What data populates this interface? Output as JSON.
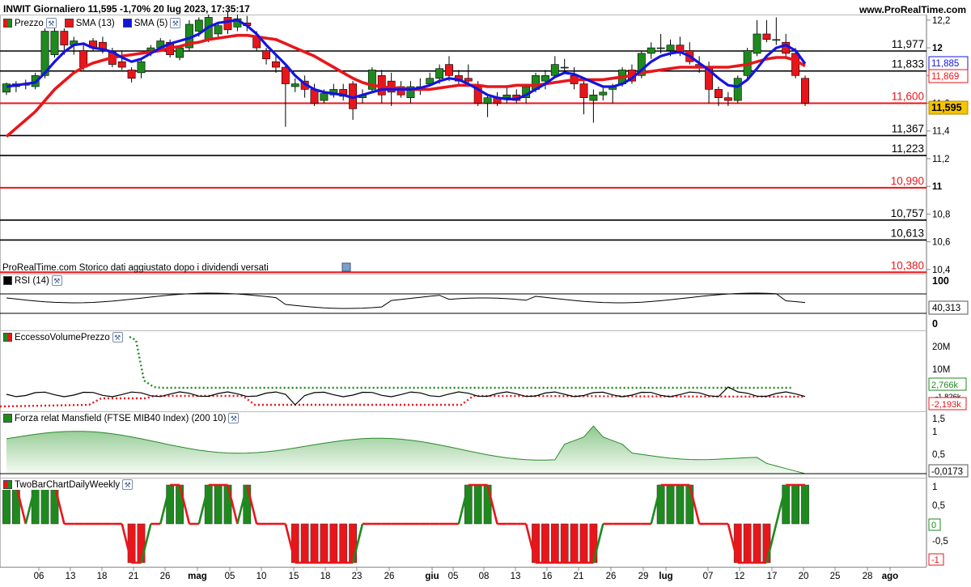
{
  "header": {
    "title": "INWIT Giornaliero 11,595 -1,70% 20 lug 2023, 17:35:17",
    "site": "www.ProRealTime.com"
  },
  "legend_price": [
    {
      "label": "Prezzo",
      "color": "#1e8a1e"
    },
    {
      "label": "SMA (13)",
      "color": "#e8161b"
    },
    {
      "label": "SMA (5)",
      "color": "#1414e0"
    }
  ],
  "note": "ProRealTime.com  Storico dati aggiustato dopo i dividendi versati",
  "panels": {
    "rsi": {
      "label": "RSI (14)",
      "value": "40,313",
      "ticks": [
        "100",
        "0"
      ]
    },
    "evp": {
      "label": "EccessoVolumePrezzo",
      "ticks": [
        "20M",
        "10M"
      ],
      "values": [
        "2,766k",
        "-1,826k",
        "-2,193k"
      ]
    },
    "mans": {
      "label": "Forza relat Mansfield (FTSE MIB40 Index) (200 10)",
      "ticks": [
        "1,5",
        "1",
        "0,5"
      ],
      "value": "-0,0173"
    },
    "twobar": {
      "label": "TwoBarChartDailyWeekly",
      "ticks": [
        "1",
        "0,5",
        "-0,5"
      ],
      "tags": [
        "0",
        "-1"
      ]
    }
  },
  "colors": {
    "up": "#1e8a1e",
    "down": "#e8161b",
    "sma13": "#e8161b",
    "sma5": "#1414e0",
    "blackline": "#000000"
  },
  "chart_data": {
    "type": "candlestick",
    "ylim": [
      10.37,
      12.24
    ],
    "price_ticks": [
      "12,2",
      "12",
      "11,8",
      "11,6",
      "11,4",
      "11,2",
      "11",
      "10,8",
      "10,6",
      "10,4"
    ],
    "x_tick_labels": [
      "06",
      "13",
      "18",
      "21",
      "26",
      "mag",
      "05",
      "10",
      "15",
      "18",
      "23",
      "26",
      "giu",
      "05",
      "08",
      "13",
      "16",
      "21",
      "26",
      "29",
      "lug",
      "07",
      "12",
      "17",
      "20",
      "25",
      "28",
      "ago"
    ],
    "current_price": "11,595",
    "sma5_last": "11,885",
    "sma13_last": "11,869",
    "levels": [
      {
        "value": 11.977,
        "label": "11,977",
        "kind": "black"
      },
      {
        "value": 11.833,
        "label": "11,833",
        "kind": "black"
      },
      {
        "value": 11.6,
        "label": "11,600",
        "kind": "red"
      },
      {
        "value": 11.367,
        "label": "11,367",
        "kind": "black"
      },
      {
        "value": 11.223,
        "label": "11,223",
        "kind": "black"
      },
      {
        "value": 10.99,
        "label": "10,990",
        "kind": "red"
      },
      {
        "value": 10.757,
        "label": "10,757",
        "kind": "black"
      },
      {
        "value": 10.613,
        "label": "10,613",
        "kind": "black"
      },
      {
        "value": 10.38,
        "label": "10,380",
        "kind": "red"
      }
    ],
    "candles": [
      [
        11.68,
        11.75,
        11.66,
        11.74
      ],
      [
        11.72,
        11.76,
        11.68,
        11.74
      ],
      [
        11.74,
        11.77,
        11.7,
        11.73
      ],
      [
        11.72,
        11.82,
        11.7,
        11.8
      ],
      [
        11.8,
        12.15,
        11.78,
        12.12
      ],
      [
        11.95,
        12.14,
        11.93,
        12.12
      ],
      [
        12.12,
        12.14,
        11.95,
        12.02
      ],
      [
        12.02,
        12.08,
        11.95,
        12.05
      ],
      [
        11.98,
        12.04,
        11.84,
        11.86
      ],
      [
        12.05,
        12.07,
        11.98,
        12.0
      ],
      [
        12.04,
        12.08,
        11.96,
        11.99
      ],
      [
        11.97,
        12.0,
        11.86,
        11.88
      ],
      [
        11.9,
        11.98,
        11.84,
        11.86
      ],
      [
        11.84,
        11.86,
        11.75,
        11.78
      ],
      [
        11.82,
        11.92,
        11.78,
        11.9
      ],
      [
        11.98,
        12.02,
        11.94,
        12.0
      ],
      [
        12.0,
        12.07,
        11.98,
        12.05
      ],
      [
        12.04,
        12.06,
        11.93,
        11.95
      ],
      [
        11.93,
        12.02,
        11.91,
        12.0
      ],
      [
        12.0,
        12.2,
        11.98,
        12.17
      ],
      [
        12.12,
        12.22,
        12.08,
        12.2
      ],
      [
        12.06,
        12.24,
        12.04,
        12.22
      ],
      [
        12.1,
        12.18,
        12.06,
        12.16
      ],
      [
        12.22,
        12.26,
        12.1,
        12.13
      ],
      [
        12.15,
        12.24,
        12.12,
        12.21
      ],
      [
        12.18,
        12.23,
        12.12,
        12.16
      ],
      [
        12.08,
        12.12,
        11.98,
        12.0
      ],
      [
        11.98,
        12.0,
        11.88,
        11.92
      ],
      [
        11.9,
        11.94,
        11.82,
        11.86
      ],
      [
        11.86,
        11.88,
        11.43,
        11.74
      ],
      [
        11.72,
        11.78,
        11.68,
        11.74
      ],
      [
        11.76,
        11.8,
        11.64,
        11.7
      ],
      [
        11.7,
        11.74,
        11.58,
        11.6
      ],
      [
        11.62,
        11.7,
        11.6,
        11.67
      ],
      [
        11.66,
        11.74,
        11.64,
        11.7
      ],
      [
        11.7,
        11.74,
        11.62,
        11.65
      ],
      [
        11.74,
        11.76,
        11.48,
        11.56
      ],
      [
        11.64,
        11.7,
        11.6,
        11.66
      ],
      [
        11.7,
        11.86,
        11.68,
        11.84
      ],
      [
        11.8,
        11.84,
        11.6,
        11.66
      ],
      [
        11.76,
        11.82,
        11.58,
        11.68
      ],
      [
        11.72,
        11.76,
        11.64,
        11.66
      ],
      [
        11.64,
        11.76,
        11.6,
        11.72
      ],
      [
        11.7,
        11.78,
        11.66,
        11.72
      ],
      [
        11.74,
        11.82,
        11.72,
        11.78
      ],
      [
        11.78,
        11.88,
        11.74,
        11.85
      ],
      [
        11.88,
        11.94,
        11.76,
        11.8
      ],
      [
        11.8,
        11.84,
        11.74,
        11.76
      ],
      [
        11.78,
        11.88,
        11.74,
        11.76
      ],
      [
        11.72,
        11.76,
        11.58,
        11.6
      ],
      [
        11.6,
        11.66,
        11.5,
        11.64
      ],
      [
        11.64,
        11.68,
        11.58,
        11.6
      ],
      [
        11.64,
        11.72,
        11.6,
        11.66
      ],
      [
        11.66,
        11.7,
        11.6,
        11.62
      ],
      [
        11.64,
        11.74,
        11.6,
        11.72
      ],
      [
        11.7,
        11.82,
        11.68,
        11.8
      ],
      [
        11.76,
        11.84,
        11.7,
        11.8
      ],
      [
        11.8,
        11.94,
        11.78,
        11.88
      ],
      [
        11.86,
        11.92,
        11.82,
        11.86
      ],
      [
        11.8,
        11.86,
        11.7,
        11.74
      ],
      [
        11.74,
        11.76,
        11.52,
        11.64
      ],
      [
        11.62,
        11.7,
        11.46,
        11.66
      ],
      [
        11.66,
        11.72,
        11.62,
        11.68
      ],
      [
        11.7,
        11.74,
        11.6,
        11.72
      ],
      [
        11.74,
        11.86,
        11.72,
        11.84
      ],
      [
        11.84,
        11.88,
        11.74,
        11.76
      ],
      [
        11.8,
        11.98,
        11.78,
        11.96
      ],
      [
        11.96,
        12.04,
        11.92,
        12.0
      ],
      [
        12.0,
        12.1,
        11.96,
        12.0
      ],
      [
        11.98,
        12.06,
        11.94,
        12.02
      ],
      [
        12.02,
        12.08,
        11.94,
        11.96
      ],
      [
        11.98,
        12.04,
        11.88,
        11.9
      ],
      [
        11.88,
        11.94,
        11.82,
        11.86
      ],
      [
        11.86,
        11.9,
        11.6,
        11.7
      ],
      [
        11.7,
        11.72,
        11.58,
        11.64
      ],
      [
        11.64,
        11.68,
        11.58,
        11.62
      ],
      [
        11.62,
        11.8,
        11.6,
        11.78
      ],
      [
        11.8,
        12.0,
        11.78,
        11.98
      ],
      [
        11.96,
        12.2,
        11.94,
        12.1
      ],
      [
        12.1,
        12.2,
        12.04,
        12.06
      ],
      [
        12.06,
        12.22,
        12.02,
        12.06
      ],
      [
        12.04,
        12.1,
        11.92,
        11.96
      ],
      [
        11.96,
        12.0,
        11.78,
        11.8
      ],
      [
        11.78,
        11.8,
        11.58,
        11.6
      ]
    ],
    "sma5": [
      11.72,
      11.73,
      11.74,
      11.75,
      11.82,
      11.9,
      11.97,
      12.02,
      12.03,
      12.0,
      11.99,
      11.97,
      11.93,
      11.9,
      11.92,
      11.96,
      12.0,
      12.03,
      12.05,
      12.07,
      12.1,
      12.15,
      12.18,
      12.19,
      12.2,
      12.16,
      12.1,
      12.02,
      11.95,
      11.88,
      11.8,
      11.74,
      11.7,
      11.68,
      11.67,
      11.66,
      11.64,
      11.66,
      11.68,
      11.7,
      11.7,
      11.7,
      11.7,
      11.71,
      11.73,
      11.76,
      11.78,
      11.77,
      11.74,
      11.7,
      11.66,
      11.64,
      11.63,
      11.63,
      11.66,
      11.7,
      11.74,
      11.79,
      11.82,
      11.81,
      11.78,
      11.75,
      11.72,
      11.72,
      11.74,
      11.78,
      11.84,
      11.9,
      11.94,
      11.96,
      11.97,
      11.94,
      11.89,
      11.84,
      11.78,
      11.73,
      11.72,
      11.77,
      11.85,
      11.94,
      12.0,
      12.02,
      11.98,
      11.885
    ],
    "sma13": [
      11.36,
      11.42,
      11.48,
      11.54,
      11.62,
      11.7,
      11.76,
      11.82,
      11.86,
      11.89,
      11.91,
      11.93,
      11.94,
      11.95,
      11.96,
      11.97,
      11.98,
      12.0,
      12.01,
      12.03,
      12.04,
      12.06,
      12.07,
      12.08,
      12.09,
      12.09,
      12.08,
      12.07,
      12.06,
      12.03,
      12.0,
      11.97,
      11.94,
      11.9,
      11.86,
      11.82,
      11.78,
      11.75,
      11.73,
      11.72,
      11.71,
      11.71,
      11.7,
      11.7,
      11.7,
      11.71,
      11.72,
      11.73,
      11.73,
      11.73,
      11.72,
      11.72,
      11.72,
      11.73,
      11.73,
      11.73,
      11.74,
      11.75,
      11.76,
      11.77,
      11.77,
      11.77,
      11.77,
      11.78,
      11.79,
      11.8,
      11.82,
      11.83,
      11.84,
      11.85,
      11.86,
      11.86,
      11.86,
      11.86,
      11.86,
      11.86,
      11.87,
      11.88,
      11.9,
      11.92,
      11.93,
      11.93,
      11.91,
      11.869
    ]
  }
}
